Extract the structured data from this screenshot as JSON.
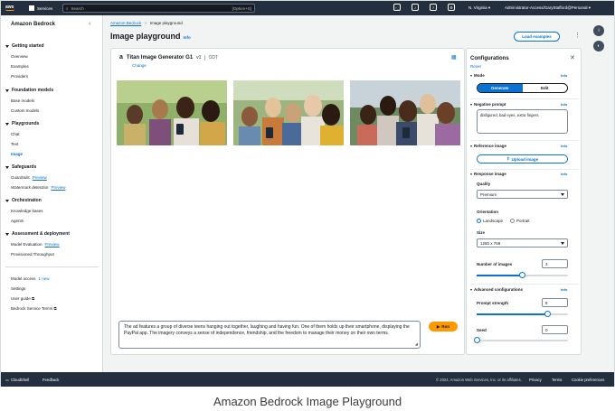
{
  "topnav": {
    "logo": "aws",
    "services_label": "Services",
    "search_placeholder": "Search",
    "search_shortcut": "[Option+S]",
    "region": "N. Virginia ▾",
    "account": "Administrator-Access/GaryStafford@Personal ▾"
  },
  "sidebar": {
    "title": "Amazon Bedrock",
    "sections": [
      {
        "label": "Getting started",
        "items": [
          "Overview",
          "Examples",
          "Providers"
        ]
      },
      {
        "label": "Foundation models",
        "items": [
          "Base models",
          "Custom models"
        ]
      },
      {
        "label": "Playgrounds",
        "items": [
          "Chat",
          "Text",
          "Image"
        ]
      },
      {
        "label": "Safeguards",
        "items": [
          "Guardrails",
          "Watermark detection"
        ]
      },
      {
        "label": "Orchestration",
        "items": [
          "Knowledge bases",
          "Agents"
        ]
      },
      {
        "label": "Assessment & deployment",
        "items": [
          "Model Evaluation",
          "Provisioned Throughput"
        ]
      }
    ],
    "preview_label": "Preview",
    "bottom_links": [
      "Model access",
      "Settings",
      "User guide",
      "Bedrock Service Terms"
    ],
    "model_access_badge": "1 new"
  },
  "breadcrumb": {
    "root": "Amazon Bedrock",
    "current": "Image playground"
  },
  "page": {
    "title": "Image playground",
    "info": "Info",
    "load_examples": "Load examples"
  },
  "model": {
    "provider_logo": "a",
    "name": "Titan Image Generator G1",
    "version": "v1",
    "mode": "ODT",
    "change": "Change"
  },
  "images": [
    {
      "name": "generated-image-1",
      "colors": [
        "#8fb068",
        "#5d7a3e",
        "#2f3a24"
      ]
    },
    {
      "name": "generated-image-2",
      "colors": [
        "#b6c9a2",
        "#7e9a62",
        "#3e4b2c"
      ]
    },
    {
      "name": "generated-image-3",
      "colors": [
        "#aab9c4",
        "#6d8a60",
        "#3a4030"
      ]
    }
  ],
  "prompt": {
    "text": "The ad features a group of diverse teens hanging out together, laughing and having fun. One of them holds up their smartphone, displaying the PayPal app. The imagery conveys a sense of independence, friendship, and the freedom to manage their money on their own terms.",
    "run_label": "Run"
  },
  "config": {
    "title": "Configurations",
    "reset": "Reset",
    "info": "Info",
    "mode_label": "Mode",
    "mode_options": [
      "Generate",
      "Edit"
    ],
    "negative_prompt_label": "Negative prompt",
    "negative_prompt_value": "disfigured, bad eyes, extra fingers",
    "reference_image_label": "Reference image",
    "upload_label": "Upload image",
    "response_image_label": "Response image",
    "quality_label": "Quality",
    "quality_value": "Premium",
    "orientation_label": "Orientation",
    "orientation_options": [
      "Landscape",
      "Portrait"
    ],
    "size_label": "Size",
    "size_value": "1280 x 768",
    "num_images_label": "Number of images",
    "num_images_value": "3",
    "num_images_fraction": 0.5,
    "advanced_label": "Advanced configurations",
    "prompt_strength_label": "Prompt strength",
    "prompt_strength_value": "8",
    "prompt_strength_fraction": 0.78,
    "seed_label": "Seed",
    "seed_value": "0",
    "seed_fraction": 0.0
  },
  "footer": {
    "cloudshell": "CloudShell",
    "feedback": "Feedback",
    "copyright": "© 2024, Amazon Web Services, Inc. or its affiliates.",
    "privacy": "Privacy",
    "terms": "Terms",
    "cookie": "Cookie preferences"
  },
  "caption": "Amazon Bedrock Image Playground",
  "colors": {
    "nav": "#232f3e",
    "link": "#0972d3",
    "run": "#ff9900"
  }
}
